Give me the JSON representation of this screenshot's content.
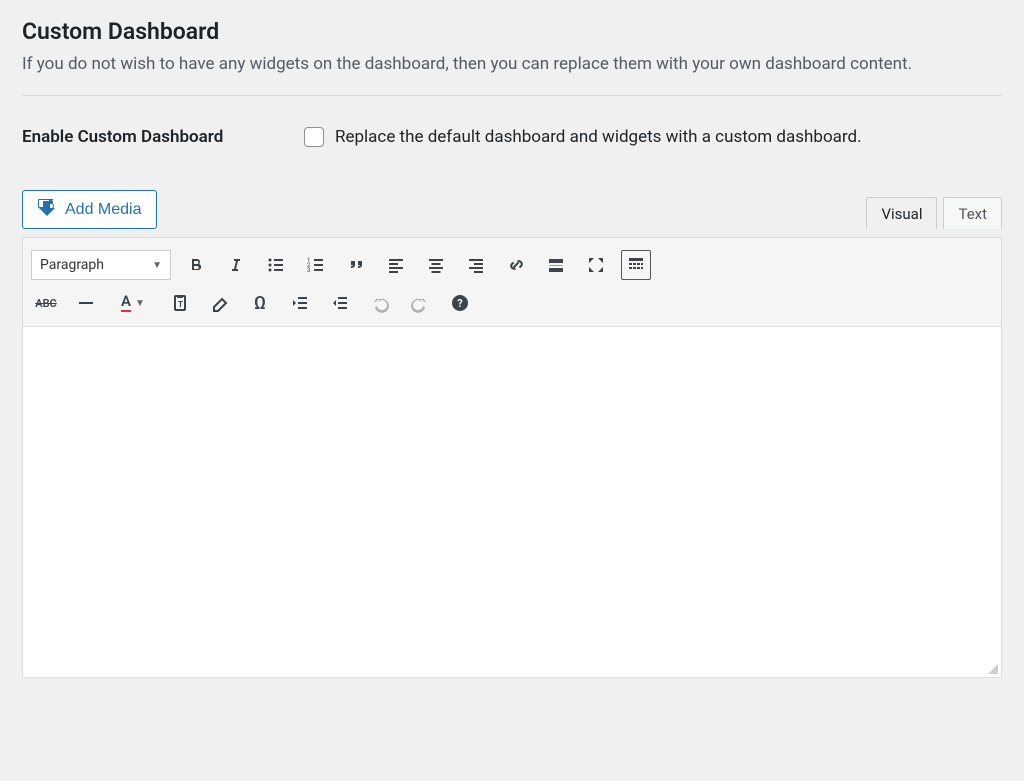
{
  "section": {
    "title": "Custom Dashboard",
    "description": "If you do not wish to have any widgets on the dashboard, then you can replace them with your own dashboard content."
  },
  "setting": {
    "label": "Enable Custom Dashboard",
    "checkbox_label": "Replace the default dashboard and widgets with a custom dashboard.",
    "checked": false
  },
  "editor": {
    "add_media_label": "Add Media",
    "tabs": {
      "visual": "Visual",
      "text": "Text",
      "active": "visual"
    },
    "format_select": "Paragraph",
    "content": "",
    "toolbar_row1": [
      "bold",
      "italic",
      "bullet-list",
      "numbered-list",
      "blockquote",
      "align-left",
      "align-center",
      "align-right",
      "link",
      "read-more",
      "fullscreen",
      "toolbar-toggle"
    ],
    "toolbar_row2": [
      "strikethrough",
      "horizontal-rule",
      "text-color",
      "paste-text",
      "clear-formatting",
      "special-character",
      "outdent",
      "indent",
      "undo",
      "redo",
      "help"
    ]
  }
}
